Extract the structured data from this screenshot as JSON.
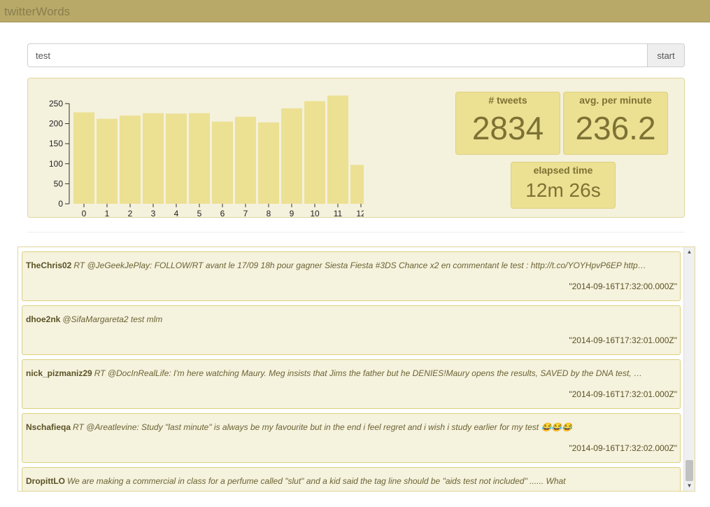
{
  "app": {
    "title": "twitterWords"
  },
  "search": {
    "value": "test",
    "button_label": "start"
  },
  "stats": {
    "tweets": {
      "label": "# tweets",
      "value": "2834"
    },
    "avg": {
      "label": "avg. per minute",
      "value": "236.2"
    },
    "elapsed": {
      "label": "elapsed time",
      "value": "12m 26s"
    }
  },
  "colors": {
    "accent": "#b8a968",
    "bar": "#ece093",
    "panel": "#f4f1dd"
  },
  "chart_data": {
    "type": "bar",
    "categories": [
      "0",
      "1",
      "2",
      "3",
      "4",
      "5",
      "6",
      "7",
      "8",
      "9",
      "10",
      "11",
      "12"
    ],
    "values": [
      228,
      212,
      220,
      226,
      225,
      226,
      205,
      217,
      203,
      238,
      256,
      270,
      97
    ],
    "yticks": [
      0,
      50,
      100,
      150,
      200,
      250
    ],
    "ylim": [
      0,
      290
    ],
    "title": "",
    "xlabel": "",
    "ylabel": ""
  },
  "tweets": [
    {
      "user": "TheChris02",
      "text": "RT @JeGeekJePlay: FOLLOW/RT avant le 17/09 18h pour gagner Siesta Fiesta #3DS Chance x2 en commentant le test : http://t.co/YOYHpvP6EP http…",
      "time": "\"2014-09-16T17:32:00.000Z\""
    },
    {
      "user": "dhoe2nk",
      "text": "@SifaMargareta2 test mlm",
      "time": "\"2014-09-16T17:32:01.000Z\""
    },
    {
      "user": "nick_pizmaniz29",
      "text": "RT @DocInRealLife: I'm here watching Maury. Meg insists that Jims the father but he DENIES!Maury opens the results, SAVED by the DNA test, …",
      "time": "\"2014-09-16T17:32:01.000Z\""
    },
    {
      "user": "Nschafieqa",
      "text": "RT @Areatlevine: Study \"last minute\" is always be my favourite but in the end i feel regret and i wish i study earlier for my test 😂😂😂",
      "time": "\"2014-09-16T17:32:02.000Z\""
    },
    {
      "user": "DropittLO",
      "text": "We are making a commercial in class for a perfume called \"slut\" and a kid said the tag line should be \"aids test not included\" ...... What",
      "time": ""
    }
  ]
}
